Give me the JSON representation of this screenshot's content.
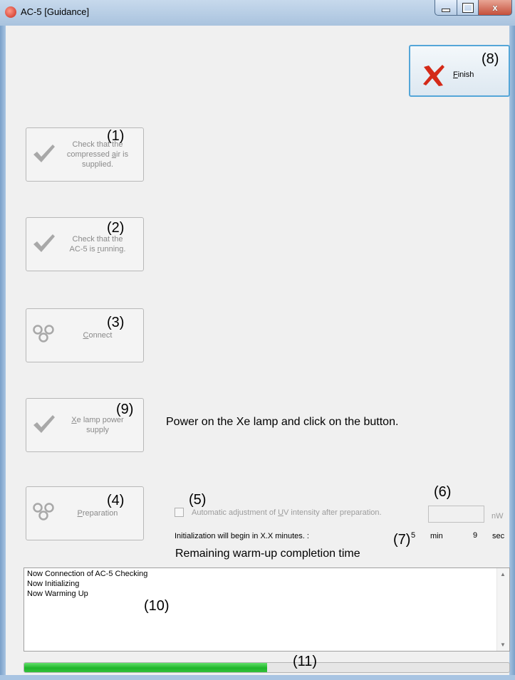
{
  "window": {
    "title": "AC-5 [Guidance]",
    "close_glyph": "x"
  },
  "finish_button": {
    "accel": "F",
    "label_rest": "inish",
    "marker": "(8)"
  },
  "guide_buttons": [
    {
      "line1": "Check that the",
      "line2_pre": "compressed ",
      "accel": "a",
      "line2_post": "ir is",
      "line3": "supplied.",
      "marker": "(1)",
      "icon": "checkmark-icon"
    },
    {
      "line1": "Check that the",
      "line2_pre": "AC-5 is ",
      "accel": "r",
      "line2_post": "unning.",
      "marker": "(2)",
      "icon": "checkmark-icon"
    },
    {
      "accel": "C",
      "label_rest": "onnect",
      "marker": "(3)",
      "icon": "connect-icon"
    },
    {
      "accel": "X",
      "label_rest": "e lamp power",
      "line2": "supply",
      "marker": "(9)",
      "icon": "checkmark-icon"
    },
    {
      "accel": "P",
      "label_rest": "reparation",
      "marker": "(4)",
      "icon": "connect-icon"
    }
  ],
  "instruction": "Power on the Xe lamp and click on the button.",
  "uv_option": {
    "label_pre": "Automatic adjustment of ",
    "accel": "U",
    "label_post": "V intensity after preparation.",
    "checked": false,
    "marker": "(5)"
  },
  "intensity": {
    "value": "",
    "unit": "nW",
    "marker": "(6)"
  },
  "init_message": "Initialization will begin in X.X minutes. :",
  "timer": {
    "minutes": "5",
    "min_label": "min",
    "seconds": "9",
    "sec_label": "sec",
    "marker": "(7)"
  },
  "remaining_label": "Remaining warm-up completion time",
  "log": {
    "lines": [
      "Now Connection of AC-5 Checking",
      "Now Initializing",
      "Now Warming Up"
    ],
    "marker": "(10)"
  },
  "progress": {
    "fraction": 0.5,
    "marker": "(11)"
  },
  "colors": {
    "progress_fill": "#1fb52a",
    "finish_x": "#d42a18",
    "title_bar": "#b9cfe6"
  }
}
